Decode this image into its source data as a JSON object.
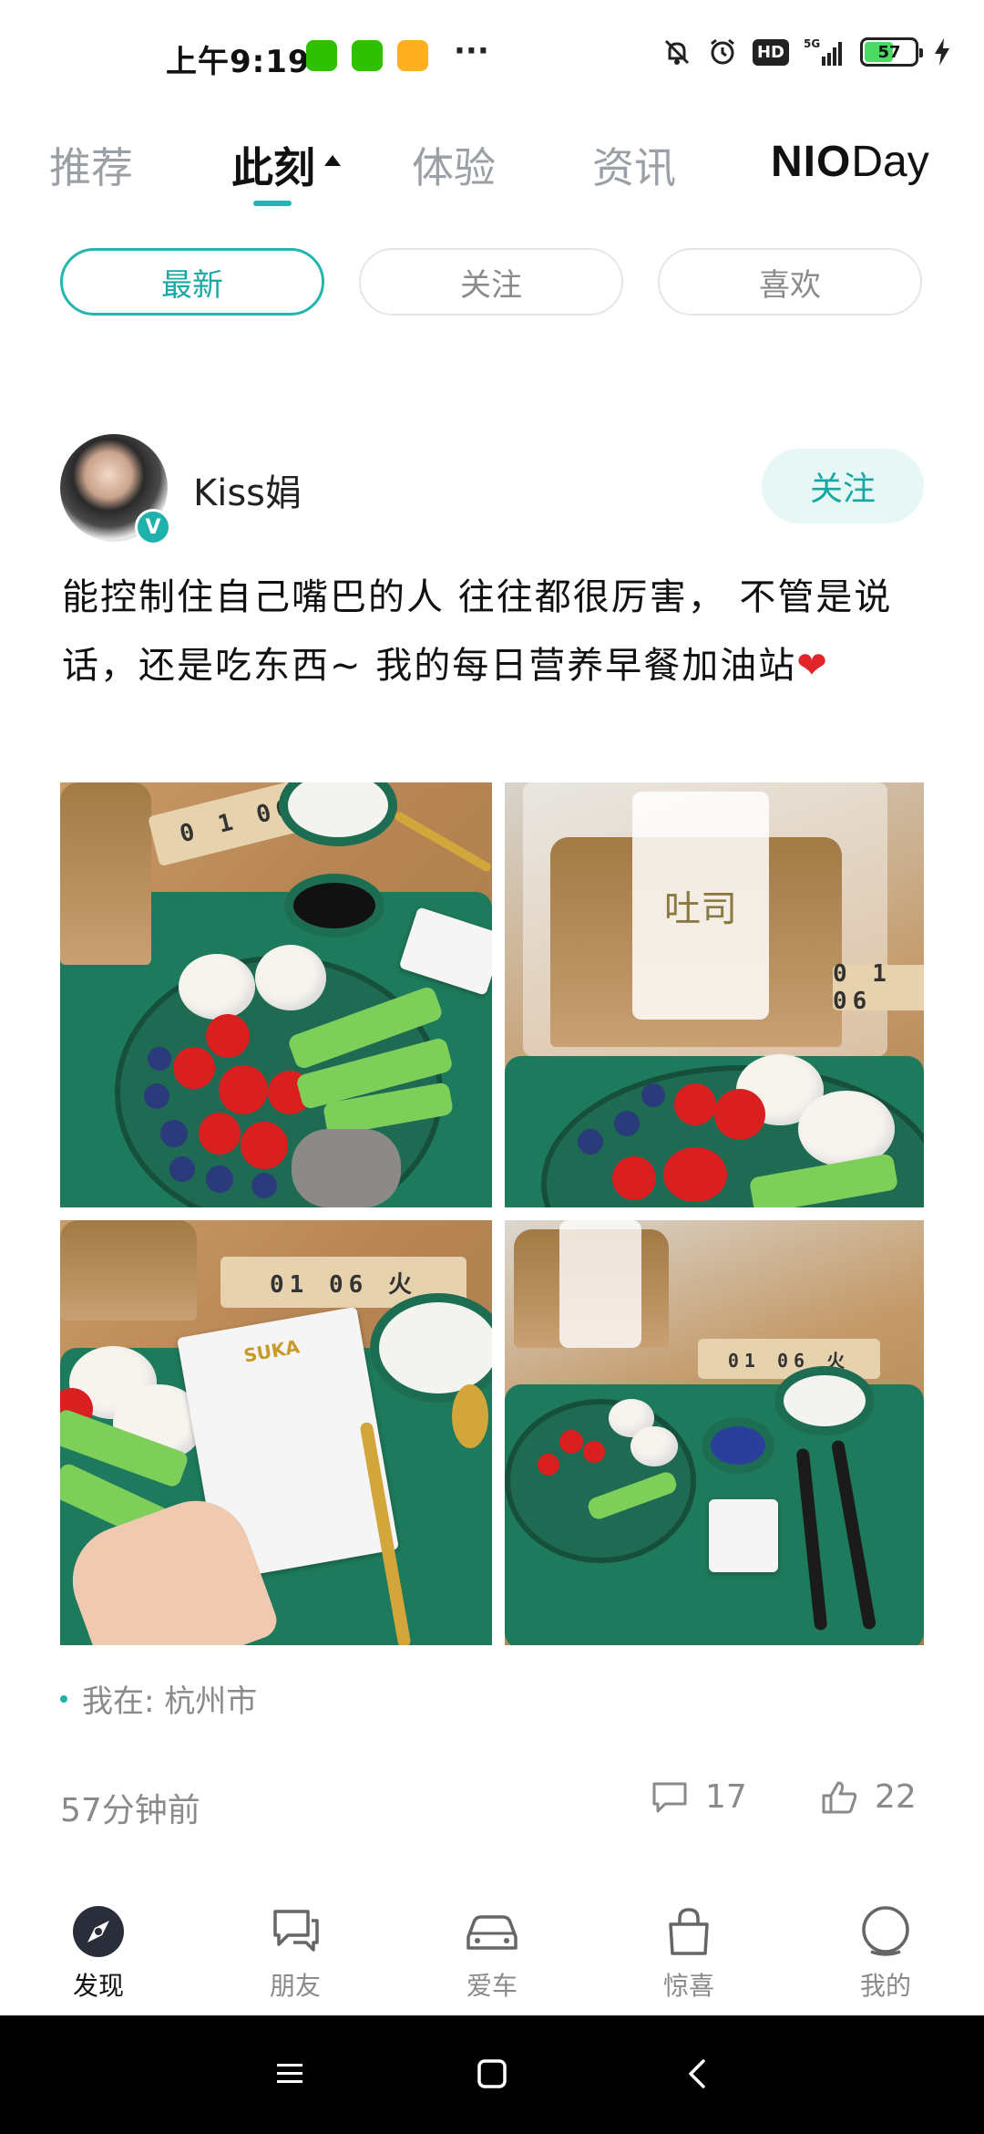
{
  "status_bar": {
    "time": "上午9:19",
    "more": "···",
    "signal": "5G",
    "battery": "57",
    "hd": "HD",
    "battery_level": 0.57
  },
  "tabs": [
    {
      "label": "推荐"
    },
    {
      "label": "此刻"
    },
    {
      "label": "体验"
    },
    {
      "label": "资讯"
    }
  ],
  "brand": {
    "bold": "NIO",
    "light": "Day"
  },
  "filters": [
    {
      "label": "最新"
    },
    {
      "label": "关注"
    },
    {
      "label": "喜欢"
    }
  ],
  "post": {
    "username": "Kiss娟",
    "follow_label": "关注",
    "verified_mark": "V",
    "text": "能控制住自己嘴巴的人 往往都很厉害， 不管是说话，还是吃东西~ 我的每日营养早餐加油站",
    "emoji": "❤",
    "photo_labels": {
      "date_block": "01 06 火",
      "date_block_short": "0 1 06",
      "bread_tag": "吐司",
      "packet_brand": "SUKA"
    },
    "location": "我在: 杭州市",
    "time_ago": "57分钟前",
    "comments": "17",
    "likes": "22"
  },
  "bottom_nav": [
    {
      "label": "发现"
    },
    {
      "label": "朋友"
    },
    {
      "label": "爱车"
    },
    {
      "label": "惊喜"
    },
    {
      "label": "我的"
    }
  ],
  "colors": {
    "accent": "#1fb2ad",
    "pill_active_border": "#24b5b0",
    "follow_bg": "#e6f7f6",
    "heart": "#e0262b"
  }
}
